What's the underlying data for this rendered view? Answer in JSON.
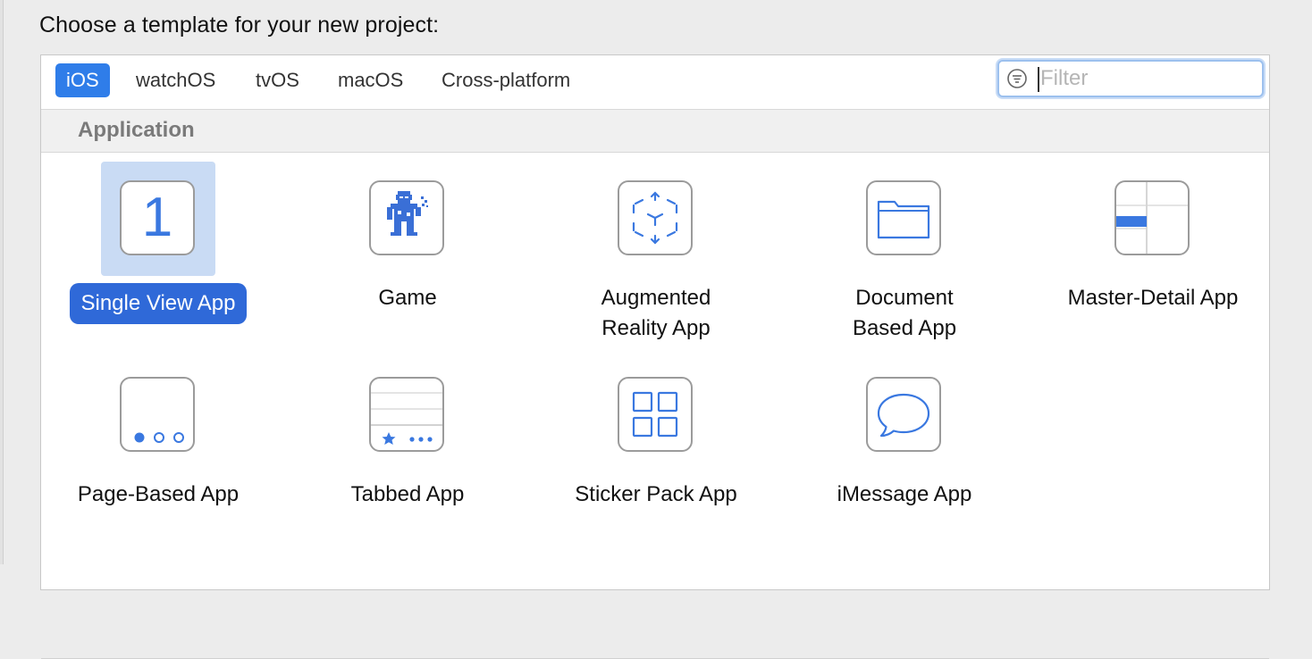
{
  "heading": "Choose a template for your new project:",
  "tabs": [
    {
      "label": "iOS",
      "selected": true
    },
    {
      "label": "watchOS",
      "selected": false
    },
    {
      "label": "tvOS",
      "selected": false
    },
    {
      "label": "macOS",
      "selected": false
    },
    {
      "label": "Cross-platform",
      "selected": false
    }
  ],
  "filter": {
    "placeholder": "Filter",
    "value": "",
    "icon": "filter-icon"
  },
  "section": {
    "title": "Application"
  },
  "templates": [
    {
      "label": "Single View App",
      "icon": "single-view-icon",
      "selected": true
    },
    {
      "label": "Game",
      "icon": "game-icon",
      "selected": false
    },
    {
      "label": "Augmented Reality App",
      "label_lines": [
        "Augmented",
        "Reality App"
      ],
      "icon": "ar-cube-icon",
      "selected": false
    },
    {
      "label": "Document Based App",
      "label_lines": [
        "Document",
        "Based App"
      ],
      "icon": "folder-icon",
      "selected": false
    },
    {
      "label": "Master-Detail App",
      "icon": "master-detail-icon",
      "selected": false
    },
    {
      "label": "Page-Based App",
      "icon": "page-dots-icon",
      "selected": false
    },
    {
      "label": "Tabbed App",
      "icon": "tab-bar-icon",
      "selected": false
    },
    {
      "label": "Sticker Pack App",
      "icon": "sticker-grid-icon",
      "selected": false
    },
    {
      "label": "iMessage App",
      "icon": "message-bubble-icon",
      "selected": false
    }
  ],
  "colors": {
    "accent": "#2f7de9",
    "selection_bg": "#c9dbf4",
    "icon_blue": "#3a78e0"
  },
  "single_view_glyph": "1"
}
